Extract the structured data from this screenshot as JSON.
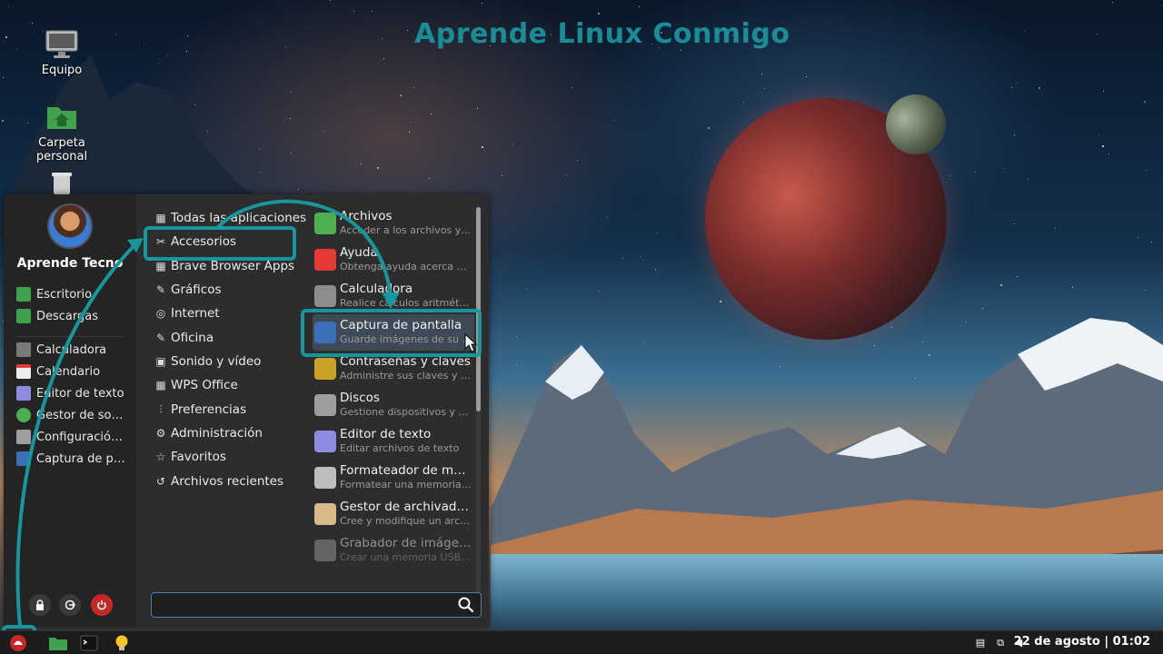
{
  "wallpaper": {
    "title": "Aprende Linux Conmigo"
  },
  "desktop_icons": [
    {
      "label": "Equipo",
      "icon": "computer-icon"
    },
    {
      "label": "Carpeta personal",
      "icon": "home-folder-icon"
    },
    {
      "label": "",
      "icon": "trash-icon"
    }
  ],
  "menu": {
    "user_name": "Aprende Tecno",
    "places": [
      {
        "label": "Escritorio",
        "color": "#3fa34d"
      },
      {
        "label": "Descargas",
        "color": "#3fa34d"
      }
    ],
    "favorites": [
      {
        "label": "Calculadora",
        "color": "#7a7a7a"
      },
      {
        "label": "Calendario",
        "color": "#e8e8e8"
      },
      {
        "label": "Editor de texto",
        "color": "#8c8ce0"
      },
      {
        "label": "Gestor de so…",
        "color": "#4caf50"
      },
      {
        "label": "Configuració…",
        "color": "#9e9e9e"
      },
      {
        "label": "Captura de p…",
        "color": "#3b6fb6"
      }
    ],
    "categories": [
      {
        "label": "Todas las aplicaciones",
        "glyph": "▦"
      },
      {
        "label": "Accesorios",
        "glyph": "✂"
      },
      {
        "label": "Brave Browser Apps",
        "glyph": "▦"
      },
      {
        "label": "Gráficos",
        "glyph": "✎"
      },
      {
        "label": "Internet",
        "glyph": "◎"
      },
      {
        "label": "Oficina",
        "glyph": "✎"
      },
      {
        "label": "Sonido y vídeo",
        "glyph": "▣"
      },
      {
        "label": "WPS Office",
        "glyph": "▦"
      },
      {
        "label": "Preferencias",
        "glyph": "⫶"
      },
      {
        "label": "Administración",
        "glyph": "⚙"
      },
      {
        "label": "Favoritos",
        "glyph": "☆"
      },
      {
        "label": "Archivos recientes",
        "glyph": "↺"
      }
    ],
    "apps": [
      {
        "name": "Archivos",
        "desc": "Acceder a los archivos y o…",
        "color": "#4caf50"
      },
      {
        "name": "Ayuda",
        "desc": "Obtenga ayuda acerca de…",
        "color": "#e53935"
      },
      {
        "name": "Calculadora",
        "desc": "Realice cálculos aritmét…",
        "color": "#8d8d8d"
      },
      {
        "name": "Captura de pantalla",
        "desc": "Guarde imágenes de su p…",
        "color": "#3b6fb6"
      },
      {
        "name": "Contraseñas y claves",
        "desc": "Administre sus claves y co…",
        "color": "#c9a227"
      },
      {
        "name": "Discos",
        "desc": "Gestione dispositivos y so…",
        "color": "#9e9e9e"
      },
      {
        "name": "Editor de texto",
        "desc": "Editar archivos de texto",
        "color": "#8c8ce0"
      },
      {
        "name": "Formateador de me…",
        "desc": "Formatear una memoria …",
        "color": "#bdbdbd"
      },
      {
        "name": "Gestor de archivado…",
        "desc": "Cree y modifique un archi…",
        "color": "#d8b98a"
      },
      {
        "name": "Grabador de imáge…",
        "desc": "Crear una memoria USB d…",
        "color": "#9e9e9e"
      }
    ],
    "search": {
      "value": "",
      "placeholder": ""
    }
  },
  "taskbar": {
    "clock": "22 de agosto | 01:02"
  },
  "colors": {
    "highlight": "#17969c",
    "accent": "#4e7fb0"
  }
}
